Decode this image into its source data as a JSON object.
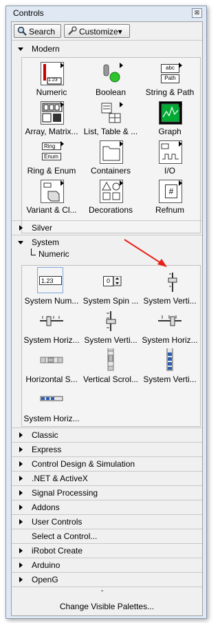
{
  "window": {
    "title": "Controls",
    "close_glyph": "⊠"
  },
  "toolbar": {
    "search_label": "Search",
    "customize_label": "Customize▾"
  },
  "modern": {
    "header": "Modern",
    "items": [
      {
        "label": "Numeric",
        "icon": "numeric-icon"
      },
      {
        "label": "Boolean",
        "icon": "boolean-icon"
      },
      {
        "label": "String & Path",
        "icon": "string-path-icon"
      },
      {
        "label": "Array, Matrix...",
        "icon": "array-matrix-icon"
      },
      {
        "label": "List, Table & ...",
        "icon": "list-table-icon"
      },
      {
        "label": "Graph",
        "icon": "graph-icon"
      },
      {
        "label": "Ring & Enum",
        "icon": "ring-enum-icon"
      },
      {
        "label": "Containers",
        "icon": "containers-icon"
      },
      {
        "label": "I/O",
        "icon": "io-icon"
      },
      {
        "label": "Variant & Cl...",
        "icon": "variant-class-icon"
      },
      {
        "label": "Decorations",
        "icon": "decorations-icon"
      },
      {
        "label": "Refnum",
        "icon": "refnum-icon"
      }
    ],
    "icon_text": {
      "numeric": "1.23",
      "string_top": "abc",
      "string_bottom": "Path",
      "ring": "Ring",
      "enum": "Enum",
      "refnum": "#"
    }
  },
  "silver": {
    "header": "Silver"
  },
  "system": {
    "header": "System",
    "sub": "Numeric",
    "items": [
      {
        "label": "System Num...",
        "icon": "system-numeric-icon"
      },
      {
        "label": "System Spin ...",
        "icon": "system-spin-icon"
      },
      {
        "label": "System Verti...",
        "icon": "system-vertical-slide-icon"
      },
      {
        "label": "System Horiz...",
        "icon": "system-horizontal-slide-icon"
      },
      {
        "label": "System Verti...",
        "icon": "system-vertical-slide2-icon"
      },
      {
        "label": "System Horiz...",
        "icon": "system-horizontal-slide2-icon"
      },
      {
        "label": "Horizontal S...",
        "icon": "horizontal-scrollbar-icon"
      },
      {
        "label": "Vertical Scrol...",
        "icon": "vertical-scrollbar-icon"
      },
      {
        "label": "System Verti...",
        "icon": "system-vertical-progress-icon"
      },
      {
        "label": "System Horiz...",
        "icon": "system-horizontal-progress-icon"
      }
    ],
    "icon_text": {
      "numeric": "1.23",
      "spin": "0"
    }
  },
  "sections": [
    "Classic",
    "Express",
    "Control Design & Simulation",
    ".NET & ActiveX",
    "Signal Processing",
    "Addons",
    "User Controls",
    "Select a Control...",
    "iRobot Create",
    "Arduino",
    "OpenG"
  ],
  "footer": {
    "chevron": "ˆ",
    "label": "Change Visible Palettes..."
  },
  "colors": {
    "window_bg": "#dfe8f3",
    "panel_bg": "#f0f0f0",
    "annotation_arrow": "#e8201a"
  }
}
